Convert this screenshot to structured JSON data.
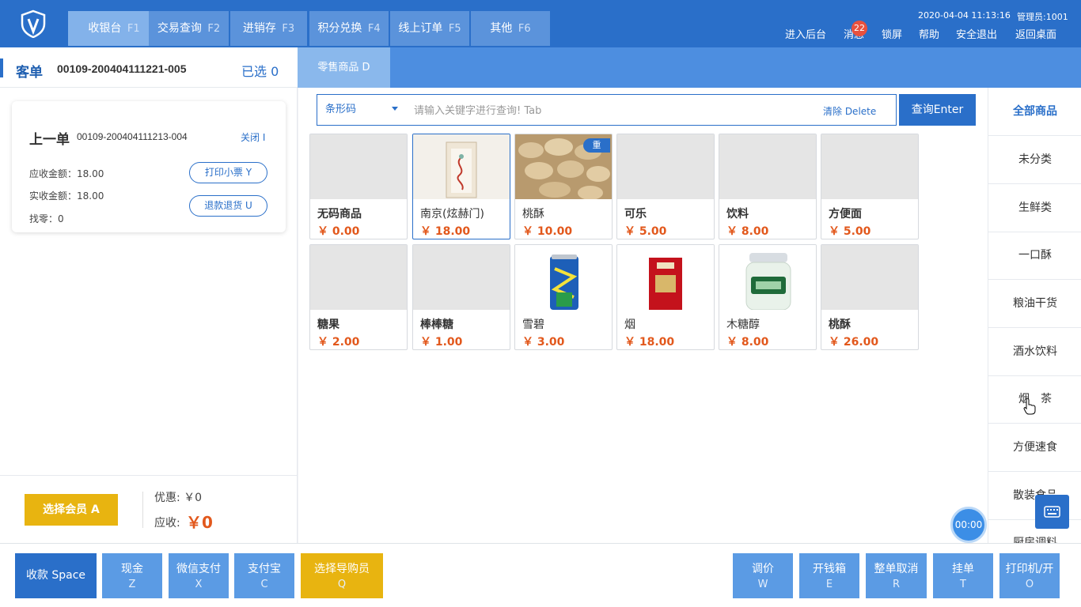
{
  "topbar": {
    "tabs": [
      {
        "label": "收银台",
        "key": "F1"
      },
      {
        "label": "交易查询",
        "key": "F2"
      },
      {
        "label": "进销存",
        "key": "F3"
      },
      {
        "label": "积分兑换",
        "key": "F4"
      },
      {
        "label": "线上订单",
        "key": "F5"
      },
      {
        "label": "其他",
        "key": "F6"
      }
    ],
    "datetime": "2020-04-04 11:13:16",
    "admin": "管理员:1001",
    "links": {
      "backend": "进入后台",
      "messages": "消息",
      "message_count": "22",
      "lock": "锁屏",
      "help": "帮助",
      "logout": "安全退出",
      "desktop": "返回桌面"
    }
  },
  "order": {
    "title": "客单",
    "number": "00109-200404111221-005",
    "selected": "已选 0"
  },
  "subtab": "零售商品 D",
  "last_order": {
    "title": "上一单",
    "number": "00109-200404111213-004",
    "close": "关闭 I",
    "receivable": "应收金额：18.00",
    "received": "实收金额：18.00",
    "change": "找零：0",
    "print_btn": "打印小票 Y",
    "refund_btn": "退款退货 U"
  },
  "member": {
    "button": "选择会员 A",
    "discount": "优惠: ￥0",
    "due_label": "应收:",
    "due_value": "￥0"
  },
  "search": {
    "type": "条形码",
    "placeholder": "请输入关键字进行查询! Tab",
    "clear": "清除 Delete",
    "query": "查询Enter"
  },
  "products": [
    {
      "name": "无码商品",
      "price": "￥ 0.00",
      "img": "none"
    },
    {
      "name": "南京(炫赫门)",
      "price": "￥ 18.00",
      "img": "cigarette-box"
    },
    {
      "name": "桃酥",
      "price": "￥ 10.00",
      "img": "pastry",
      "tag": "重"
    },
    {
      "name": "可乐",
      "price": "￥ 5.00",
      "img": "none"
    },
    {
      "name": "饮料",
      "price": "￥ 8.00",
      "img": "none"
    },
    {
      "name": "方便面",
      "price": "￥ 5.00",
      "img": "none"
    },
    {
      "name": "糖果",
      "price": "￥ 2.00",
      "img": "none"
    },
    {
      "name": "棒棒糖",
      "price": "￥ 1.00",
      "img": "none"
    },
    {
      "name": "雪碧",
      "price": "￥ 3.00",
      "img": "soda-can"
    },
    {
      "name": "烟",
      "price": "￥ 18.00",
      "img": "cigarette-red"
    },
    {
      "name": "木糖醇",
      "price": "￥ 8.00",
      "img": "gum-bottle"
    },
    {
      "name": "桃酥",
      "price": "￥ 26.00",
      "img": "none"
    }
  ],
  "categories": [
    "全部商品",
    "未分类",
    "生鲜类",
    "一口酥",
    "粮油干货",
    "酒水饮料",
    "烟　茶",
    "方便速食",
    "散装食品",
    "厨房调料"
  ],
  "timer": "00:00",
  "bottom": {
    "pay": "收款 Space",
    "cash": {
      "label": "现金",
      "key": "Z"
    },
    "wechat": {
      "label": "微信支付",
      "key": "X"
    },
    "alipay": {
      "label": "支付宝",
      "key": "C"
    },
    "guide": {
      "label": "选择导购员",
      "key": "Q"
    },
    "adjust": {
      "label": "调价",
      "key": "W"
    },
    "drawer": {
      "label": "开钱箱",
      "key": "E"
    },
    "cancel": {
      "label": "整单取消",
      "key": "R"
    },
    "hold": {
      "label": "挂单",
      "key": "T"
    },
    "printer": {
      "label": "打印机/开",
      "key": "O"
    }
  },
  "colors": {
    "primary": "#2a6fc9",
    "tab": "#5b93db",
    "accent": "#e8b410",
    "price": "#e2581c"
  }
}
